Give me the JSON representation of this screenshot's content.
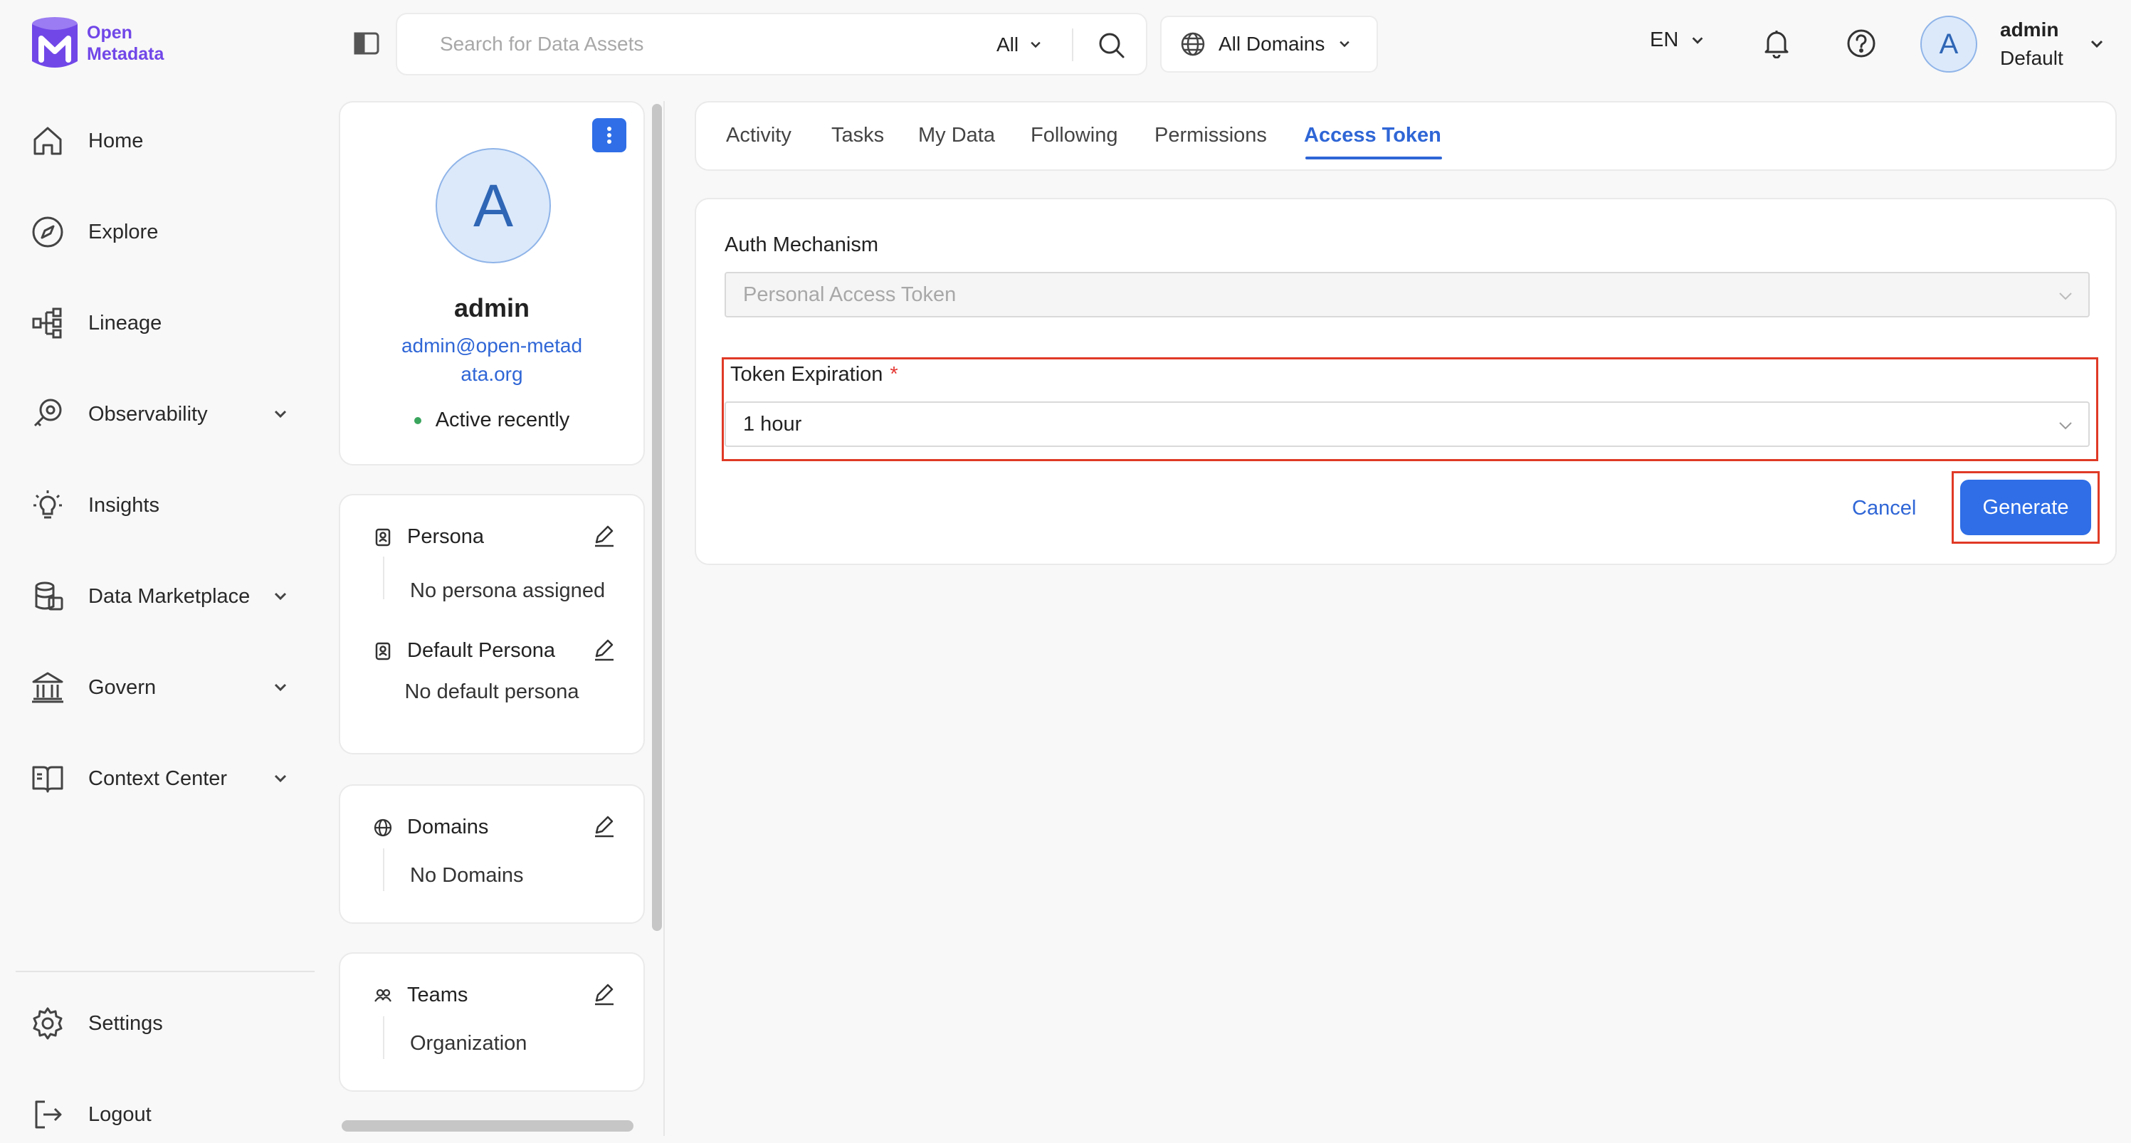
{
  "brand": {
    "name_line1": "Open",
    "name_line2": "Metadata",
    "color": "#7147e8"
  },
  "sidebar": {
    "items": [
      {
        "label": "Home",
        "icon": "home-icon",
        "has_chevron": false
      },
      {
        "label": "Explore",
        "icon": "compass-icon",
        "has_chevron": false
      },
      {
        "label": "Lineage",
        "icon": "lineage-icon",
        "has_chevron": false
      },
      {
        "label": "Observability",
        "icon": "observability-icon",
        "has_chevron": true
      },
      {
        "label": "Insights",
        "icon": "lightbulb-icon",
        "has_chevron": false
      },
      {
        "label": "Data Marketplace",
        "icon": "marketplace-icon",
        "has_chevron": true
      },
      {
        "label": "Govern",
        "icon": "bank-icon",
        "has_chevron": true
      },
      {
        "label": "Context Center",
        "icon": "book-icon",
        "has_chevron": true
      }
    ],
    "bottom": [
      {
        "label": "Settings",
        "icon": "gear-icon"
      },
      {
        "label": "Logout",
        "icon": "logout-icon"
      }
    ]
  },
  "topbar": {
    "search_placeholder": "Search for Data Assets",
    "search_scope": "All",
    "domain_select": "All Domains",
    "language": "EN",
    "user": {
      "initial": "A",
      "name": "admin",
      "role": "Default"
    }
  },
  "profile": {
    "initial": "A",
    "name": "admin",
    "email": "admin@open-metadata.org",
    "status": "Active recently",
    "persona": {
      "title": "Persona",
      "value": "No persona assigned"
    },
    "default_persona": {
      "title": "Default Persona",
      "value": "No default persona"
    },
    "domains": {
      "title": "Domains",
      "value": "No Domains"
    },
    "teams": {
      "title": "Teams",
      "value": "Organization"
    }
  },
  "tabs": [
    {
      "label": "Activity",
      "active": false
    },
    {
      "label": "Tasks",
      "active": false
    },
    {
      "label": "My Data",
      "active": false
    },
    {
      "label": "Following",
      "active": false
    },
    {
      "label": "Permissions",
      "active": false
    },
    {
      "label": "Access Token",
      "active": true
    }
  ],
  "token_form": {
    "auth_label": "Auth Mechanism",
    "auth_value": "Personal Access Token",
    "expiration_label": "Token Expiration",
    "required_mark": "*",
    "expiration_value": "1 hour",
    "cancel_label": "Cancel",
    "generate_label": "Generate"
  },
  "colors": {
    "accent": "#2f6ee6",
    "link": "#2f66d6",
    "highlight": "#e03a26",
    "status_active": "#3aa55d"
  }
}
